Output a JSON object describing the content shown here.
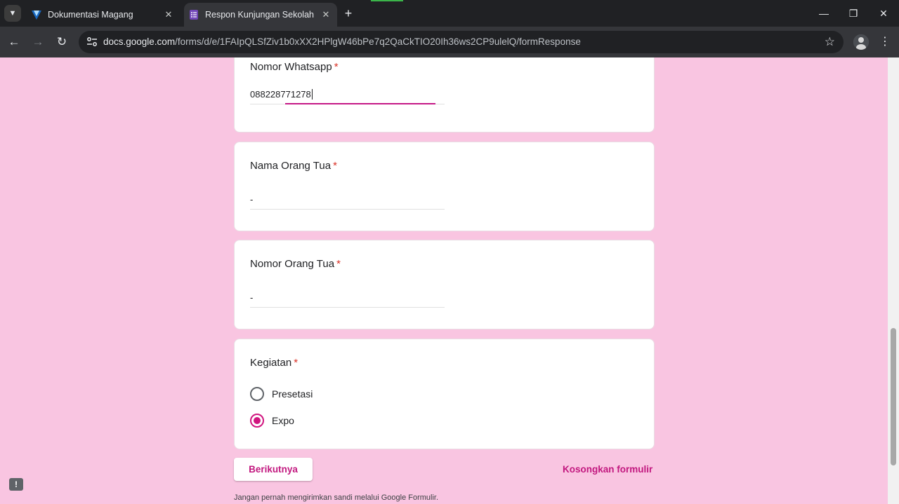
{
  "browser": {
    "tabs": [
      {
        "title": "Dokumentasi Magang",
        "icon": "vuetify-icon",
        "active": false
      },
      {
        "title": "Respon Kunjungan Sekolah",
        "icon": "google-forms-icon",
        "active": true
      }
    ],
    "url_domain": "docs.google.com",
    "url_path": "/forms/d/e/1FAIpQLSfZiv1b0xXX2HPlgW46bPe7q2QaCkTIO20Ih36ws2CP9ulelQ/formResponse"
  },
  "form": {
    "accent_color": "#c51887",
    "background_color": "#f9c5e1",
    "required_marker": "*",
    "questions": [
      {
        "label": "Nomor Whatsapp",
        "value": "088228771278",
        "focused": true
      },
      {
        "label": "Nama Orang Tua",
        "value": "-"
      },
      {
        "label": "Nomor Orang Tua",
        "value": "-"
      }
    ],
    "choice_question": {
      "label": "Kegiatan",
      "options": [
        {
          "label": "Presetasi",
          "selected": false
        },
        {
          "label": "Expo",
          "selected": true
        }
      ]
    },
    "next_button": "Berikutnya",
    "clear_link": "Kosongkan formulir",
    "footer_note": "Jangan pernah mengirimkan sandi melalui Google Formulir."
  }
}
